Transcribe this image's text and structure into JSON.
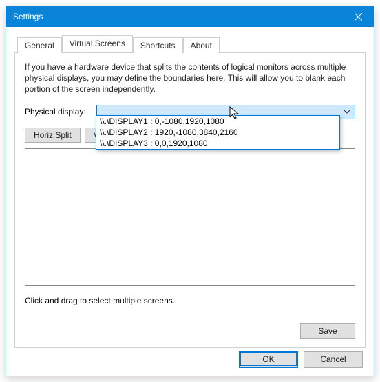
{
  "window": {
    "title": "Settings"
  },
  "tabs": {
    "items": [
      {
        "label": "General"
      },
      {
        "label": "Virtual Screens"
      },
      {
        "label": "Shortcuts"
      },
      {
        "label": "About"
      }
    ],
    "active_index": 1
  },
  "panel": {
    "description": "If you have a hardware device that splits the contents of logical monitors across multiple physical displays, you may define the boundaries here. This will allow you to blank each portion of the screen independently.",
    "display_label": "Physical display:",
    "combo_value": "",
    "horiz_split_label": "Horiz Split",
    "vert_split_label": "Ve",
    "hint": "Click and drag to select multiple screens.",
    "save_label": "Save"
  },
  "dropdown": {
    "options": [
      "\\\\.\\DISPLAY1 : 0,-1080,1920,1080",
      "\\\\.\\DISPLAY2 : 1920,-1080,3840,2160",
      "\\\\.\\DISPLAY3 : 0,0,1920,1080"
    ]
  },
  "buttons": {
    "ok": "OK",
    "cancel": "Cancel"
  }
}
